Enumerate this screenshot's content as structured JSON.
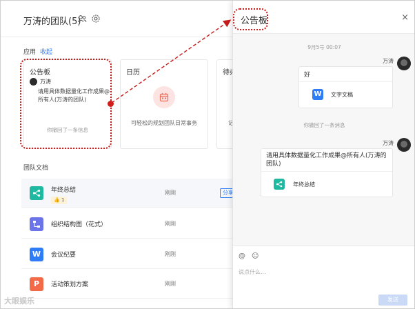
{
  "team": {
    "title": "万涛的团队(5)",
    "members_icon": "people-icon",
    "settings_icon": "gear-icon"
  },
  "apps": {
    "label": "应用",
    "collapse": "收起",
    "cards": [
      {
        "title": "公告板",
        "user": "万涛",
        "body": "请用具体数据量化工作成果@所有人(万涛的团队)",
        "revoked": "你撤回了一条信息"
      },
      {
        "title": "日历",
        "icon": "calendar-icon",
        "desc": "可轻松的规划团队日常事务"
      },
      {
        "title": "待办",
        "desc": "记"
      }
    ]
  },
  "docs": {
    "title": "团队文档",
    "items": [
      {
        "name": "年终总结",
        "time": "刚刚",
        "icon": "mindmap-icon",
        "color": "#1fb8a0",
        "likes": "👍 1",
        "action": "分享"
      },
      {
        "name": "组织结构图（花式）",
        "time": "刚刚",
        "icon": "orgchart-icon",
        "color": "#6b74e8"
      },
      {
        "name": "会议纪要",
        "time": "刚刚",
        "icon": "word-doc-icon",
        "color": "#2f7df6",
        "glyph": "W"
      },
      {
        "name": "活动策划方案",
        "time": "刚刚",
        "icon": "ppt-icon",
        "color": "#f26a47",
        "glyph": "P"
      }
    ]
  },
  "panel": {
    "title": "公告板",
    "close": "×",
    "date": "9月5号 00:07",
    "messages": [
      {
        "sender": "万涛",
        "text": "好",
        "attachment": {
          "name": "文字文稿",
          "icon": "word-doc-icon",
          "glyph": "W",
          "color": "#2f7df6"
        }
      },
      {
        "sender": "万涛",
        "text": "请用具体数据量化工作成果@所有人(万涛的团队)",
        "attachment": {
          "name": "年终总结",
          "icon": "mindmap-icon",
          "color": "#1fb8a0"
        }
      }
    ],
    "revoked": "你撤回了一条消息",
    "composer": {
      "at": "@",
      "emoji": "☺",
      "placeholder": "说点什么...",
      "send": "发送"
    }
  },
  "watermark": "大眼娱乐"
}
